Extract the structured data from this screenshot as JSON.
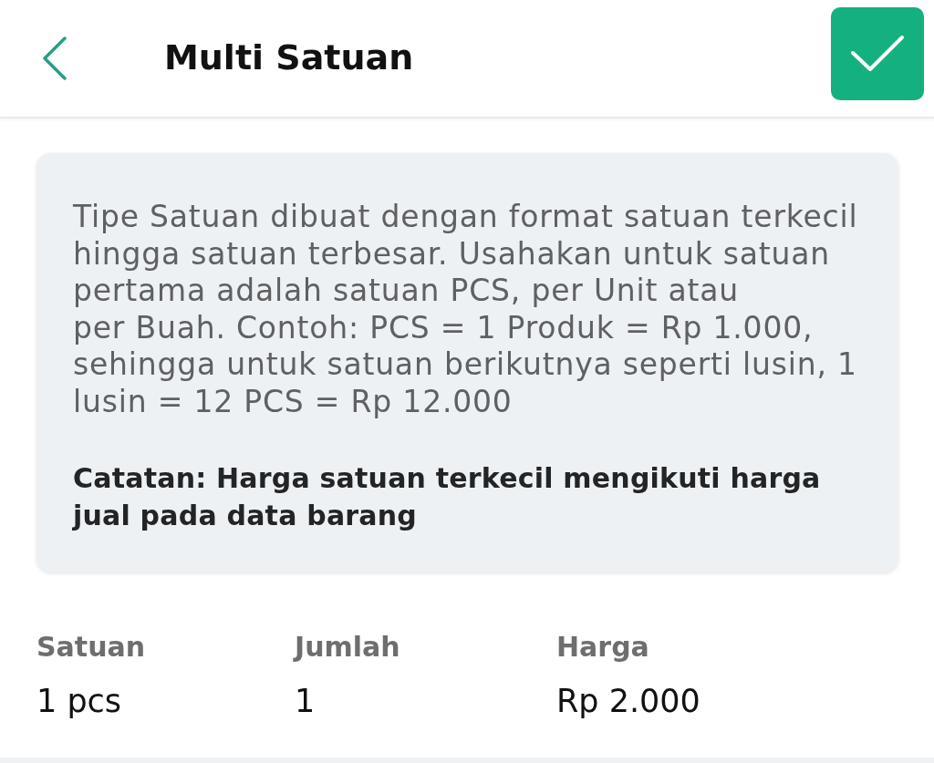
{
  "header": {
    "title": "Multi Satuan"
  },
  "info_card": {
    "description": "Tipe Satuan dibuat dengan format satuan terkecil\nhingga satuan terbesar. Usahakan untuk satuan\npertama adalah satuan PCS, per Unit atau\nper Buah. Contoh: PCS = 1 Produk = Rp 1.000,\nsehingga untuk satuan berikutnya seperti lusin, 1\nlusin = 12 PCS = Rp 12.000",
    "note": "Catatan: Harga satuan terkecil mengikuti harga\njual pada data barang"
  },
  "table": {
    "columns": [
      "Satuan",
      "Jumlah",
      "Harga"
    ],
    "rows": [
      [
        "1 pcs",
        "1",
        "Rp 2.000"
      ]
    ]
  }
}
